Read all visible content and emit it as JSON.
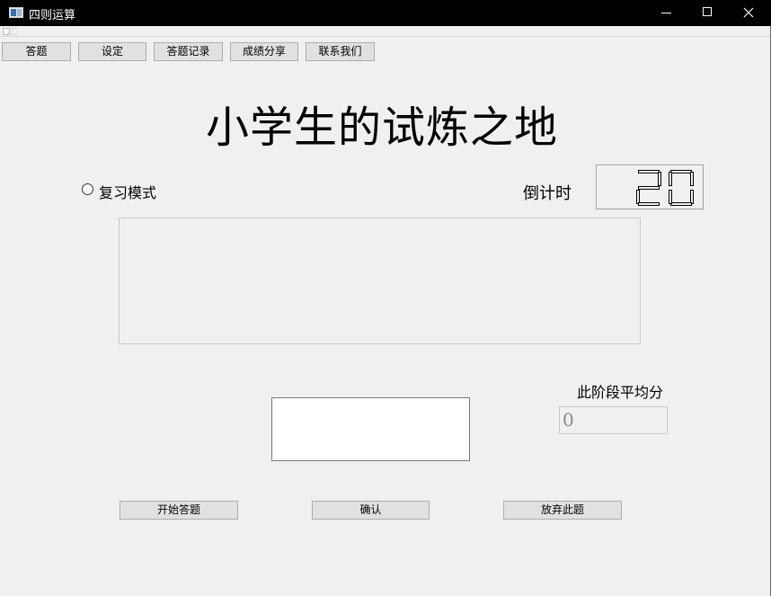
{
  "window": {
    "title": "四则运算"
  },
  "tabs": [
    {
      "label": "答题"
    },
    {
      "label": "设定"
    },
    {
      "label": "答题记录"
    },
    {
      "label": "成绩分享"
    },
    {
      "label": "联系我们"
    }
  ],
  "main": {
    "title": "小学生的试炼之地",
    "review_mode": {
      "label": "复习模式",
      "checked": false
    },
    "countdown": {
      "label": "倒计时",
      "value": "20"
    },
    "question_display": "",
    "answer_input": "",
    "average": {
      "label": "此阶段平均分",
      "value": "0"
    }
  },
  "actions": {
    "start_label": "开始答题",
    "confirm_label": "确认",
    "skip_label": "放弃此题"
  }
}
